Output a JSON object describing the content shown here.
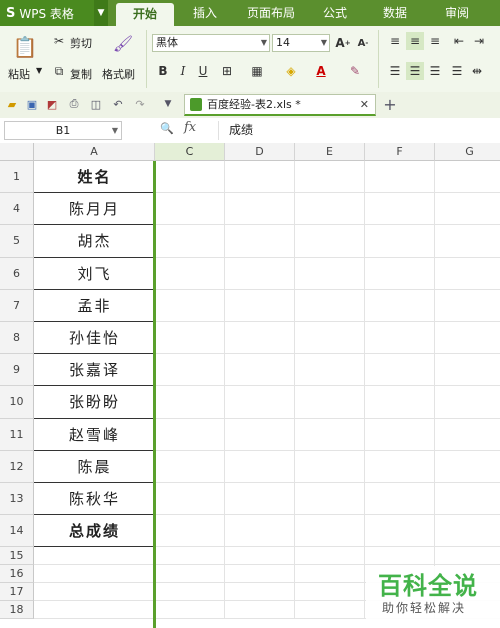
{
  "app": {
    "logo": "S",
    "name": "WPS 表格"
  },
  "menu_tabs": [
    "开始",
    "插入",
    "页面布局",
    "公式",
    "数据",
    "审阅"
  ],
  "ribbon": {
    "paste_label": "粘贴",
    "cut_label": "剪切",
    "copy_label": "复制",
    "format_painter_label": "格式刷",
    "font_name": "黑体",
    "font_size": "14",
    "bold": "B",
    "italic": "I",
    "underline": "U"
  },
  "document_tab": {
    "title": "百度经验-表2.xls *"
  },
  "formula_bar": {
    "cell_ref": "B1",
    "fx_label": "fx",
    "value": "成绩"
  },
  "columns": [
    "A",
    "C",
    "D",
    "E",
    "F",
    "G"
  ],
  "rows": [
    {
      "num": "1",
      "value": "姓名",
      "bold": true
    },
    {
      "num": "4",
      "value": "陈月月"
    },
    {
      "num": "5",
      "value": "胡杰"
    },
    {
      "num": "6",
      "value": "刘飞"
    },
    {
      "num": "7",
      "value": "孟非"
    },
    {
      "num": "8",
      "value": "孙佳怡"
    },
    {
      "num": "9",
      "value": "张嘉译"
    },
    {
      "num": "10",
      "value": "张盼盼"
    },
    {
      "num": "11",
      "value": "赵雪峰"
    },
    {
      "num": "12",
      "value": "陈晨"
    },
    {
      "num": "13",
      "value": "陈秋华"
    },
    {
      "num": "14",
      "value": "总成绩",
      "bold": true
    }
  ],
  "empty_rows": [
    "15",
    "16",
    "17",
    "18"
  ],
  "watermark": {
    "title": "百科全说",
    "subtitle": "助你轻松解决"
  },
  "colors": {
    "accent": "#5aa02c",
    "title_bar": "#5b8f2e",
    "ribbon_bg": "#f2f7ec",
    "watermark": "#43b34a"
  }
}
